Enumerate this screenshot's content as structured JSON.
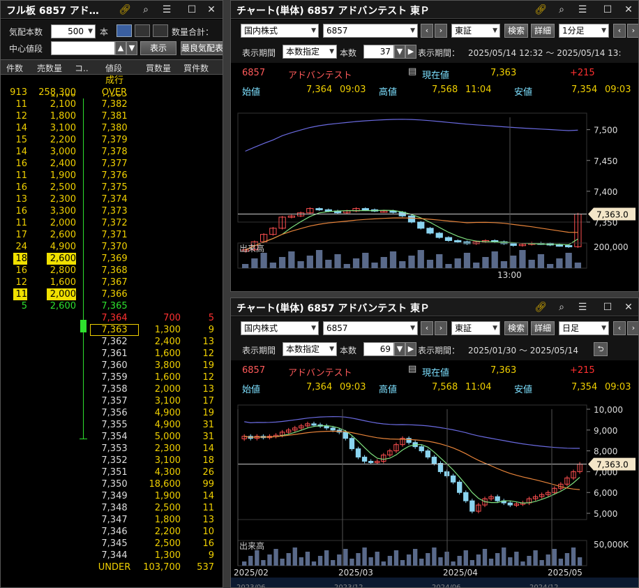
{
  "board": {
    "title": "フル板 6857 アド…",
    "kehai_label": "気配本数",
    "kehai_value": "500",
    "hon": "本",
    "suryo_label": "数量合計：",
    "center_label": "中心値段",
    "display_btn": "表示",
    "latest_btn": "最良気配表",
    "headers": {
      "count": "件数",
      "sell_qty": "売数量",
      "c": "コ..",
      "price": "値段",
      "buy_qty": "買数量",
      "buy_count": "買件数"
    },
    "market": "成行",
    "over": {
      "count": "913",
      "qty": "258,300",
      "label": "OVER"
    },
    "partial_top": {
      "qty": "1,400",
      "price": "7,383"
    },
    "asks": [
      {
        "count": "11",
        "qty": "2,100",
        "price": "7,382"
      },
      {
        "count": "12",
        "qty": "1,800",
        "price": "7,381"
      },
      {
        "count": "14",
        "qty": "3,100",
        "price": "7,380"
      },
      {
        "count": "15",
        "qty": "2,200",
        "price": "7,379"
      },
      {
        "count": "14",
        "qty": "3,000",
        "price": "7,378"
      },
      {
        "count": "16",
        "qty": "2,400",
        "price": "7,377"
      },
      {
        "count": "11",
        "qty": "1,900",
        "price": "7,376"
      },
      {
        "count": "16",
        "qty": "2,500",
        "price": "7,375"
      },
      {
        "count": "13",
        "qty": "2,300",
        "price": "7,374"
      },
      {
        "count": "16",
        "qty": "3,300",
        "price": "7,373"
      },
      {
        "count": "11",
        "qty": "2,000",
        "price": "7,372"
      },
      {
        "count": "17",
        "qty": "2,600",
        "price": "7,371"
      },
      {
        "count": "24",
        "qty": "4,900",
        "price": "7,370"
      },
      {
        "count": "18",
        "qty": "2,600",
        "price": "7,369",
        "hl": true
      },
      {
        "count": "16",
        "qty": "2,800",
        "price": "7,368"
      },
      {
        "count": "12",
        "qty": "1,600",
        "price": "7,367"
      },
      {
        "count": "11",
        "qty": "2,000",
        "price": "7,366",
        "hl": true
      },
      {
        "count": "5",
        "qty": "2,600",
        "price": "7,365",
        "green": true
      }
    ],
    "bids": [
      {
        "price": "7,364",
        "qty": "700",
        "count": "5",
        "red": true
      },
      {
        "price": "7,363",
        "qty": "1,300",
        "count": "9",
        "box": true
      },
      {
        "price": "7,362",
        "qty": "2,400",
        "count": "13"
      },
      {
        "price": "7,361",
        "qty": "1,600",
        "count": "12"
      },
      {
        "price": "7,360",
        "qty": "3,800",
        "count": "19"
      },
      {
        "price": "7,359",
        "qty": "1,600",
        "count": "12"
      },
      {
        "price": "7,358",
        "qty": "2,000",
        "count": "13"
      },
      {
        "price": "7,357",
        "qty": "3,100",
        "count": "17"
      },
      {
        "price": "7,356",
        "qty": "4,900",
        "count": "19"
      },
      {
        "price": "7,355",
        "qty": "4,900",
        "count": "31"
      },
      {
        "price": "7,354",
        "qty": "5,000",
        "count": "31"
      },
      {
        "price": "7,353",
        "qty": "2,300",
        "count": "14"
      },
      {
        "price": "7,352",
        "qty": "3,100",
        "count": "18"
      },
      {
        "price": "7,351",
        "qty": "4,300",
        "count": "26"
      },
      {
        "price": "7,350",
        "qty": "18,600",
        "count": "99"
      },
      {
        "price": "7,349",
        "qty": "1,900",
        "count": "14"
      },
      {
        "price": "7,348",
        "qty": "2,500",
        "count": "11"
      },
      {
        "price": "7,347",
        "qty": "1,800",
        "count": "13"
      },
      {
        "price": "7,346",
        "qty": "2,200",
        "count": "10"
      },
      {
        "price": "7,345",
        "qty": "2,500",
        "count": "16"
      },
      {
        "price": "7,344",
        "qty": "1,300",
        "count": "9"
      }
    ],
    "under": {
      "label": "UNDER",
      "qty": "103,700",
      "count": "537"
    }
  },
  "chart1": {
    "title": "チャート(単体) 6857 アドバンテスト 東Ｐ",
    "market": "国内株式",
    "code": "6857",
    "exchange": "東証",
    "search_btn": "検索",
    "detail_btn": "詳細",
    "interval": "1分足",
    "period_label": "表示期間",
    "period_mode": "本数指定",
    "count_label": "本数",
    "count": "37",
    "range_label": "表示期間：",
    "range": "2025/05/14 12:32 ～ 2025/05/14 13:",
    "code_red": "6857",
    "name": "アドバンテスト",
    "price_label": "現在値",
    "price": "7,363",
    "change": "+215",
    "open_label": "始値",
    "open": "7,364",
    "open_time": "09:03",
    "high_label": "高値",
    "high": "7,568",
    "high_time": "11:04",
    "low_label": "安値",
    "low": "7,354",
    "low_time": "09:03",
    "y_ticks": [
      "7,500",
      "7,450",
      "7,400",
      "7,350"
    ],
    "last_tag": "7,363.0",
    "vol_label": "出来高",
    "vol_tick": "200,000",
    "x_tick": "13:00"
  },
  "chart2": {
    "title": "チャート(単体) 6857 アドバンテスト 東Ｐ",
    "market": "国内株式",
    "code": "6857",
    "exchange": "東証",
    "search_btn": "検索",
    "detail_btn": "詳細",
    "interval": "日足",
    "period_label": "表示期間",
    "period_mode": "本数指定",
    "count_label": "本数",
    "count": "69",
    "range_label": "表示期間：",
    "range": "2025/01/30 ～ 2025/05/14",
    "code_red": "6857",
    "name": "アドバンテスト",
    "price_label": "現在値",
    "price": "7,363",
    "change": "+215",
    "open_label": "始値",
    "open": "7,364",
    "open_time": "09:03",
    "high_label": "高値",
    "high": "7,568",
    "high_time": "11:04",
    "low_label": "安値",
    "low": "7,354",
    "low_time": "09:03",
    "y_ticks": [
      "10,000",
      "9,000",
      "8,000",
      "7,000",
      "6,000",
      "5,000"
    ],
    "last_tag": "7,363.0",
    "vol_label": "出来高",
    "vol_tick": "50,000K",
    "x_ticks": [
      "2025/02",
      "2025/03",
      "2025/04",
      "2025/05"
    ],
    "nav_ticks": [
      "2023/06",
      "2023/12",
      "2024/06",
      "2024/12"
    ]
  },
  "chart_data": [
    {
      "type": "candlestick",
      "title": "",
      "interval": "1分足",
      "ylim": [
        7350,
        7520
      ],
      "close_approx": [
        7305,
        7318,
        7330,
        7340,
        7358,
        7360,
        7365,
        7372,
        7370,
        7368,
        7365,
        7368,
        7372,
        7370,
        7368,
        7368,
        7366,
        7360,
        7350,
        7340,
        7332,
        7325,
        7320,
        7318,
        7315,
        7318,
        7320,
        7318,
        7315,
        7312,
        7314,
        7316,
        7315,
        7313,
        7312,
        7310,
        7363
      ],
      "volume_max": 200000
    },
    {
      "type": "candlestick",
      "title": "",
      "interval": "日足",
      "ylim": [
        4700,
        10000
      ],
      "x_months": [
        "2025/02",
        "2025/03",
        "2025/04",
        "2025/05"
      ],
      "close_approx": [
        8700,
        8600,
        8700,
        8650,
        8700,
        8750,
        8900,
        9000,
        9100,
        9200,
        9300,
        9250,
        9200,
        9100,
        9000,
        8900,
        8600,
        8100,
        7700,
        7500,
        7450,
        7500,
        7800,
        8000,
        8300,
        8600,
        8400,
        8200,
        8000,
        7700,
        7400,
        7000,
        6800,
        6500,
        6000,
        5600,
        5100,
        5400,
        5700,
        5800,
        5600,
        5500,
        5400,
        5450,
        5500,
        5700,
        5800,
        5900,
        6000,
        6200,
        6400,
        6700,
        7000,
        7363
      ],
      "volume_max": 50000000
    }
  ]
}
